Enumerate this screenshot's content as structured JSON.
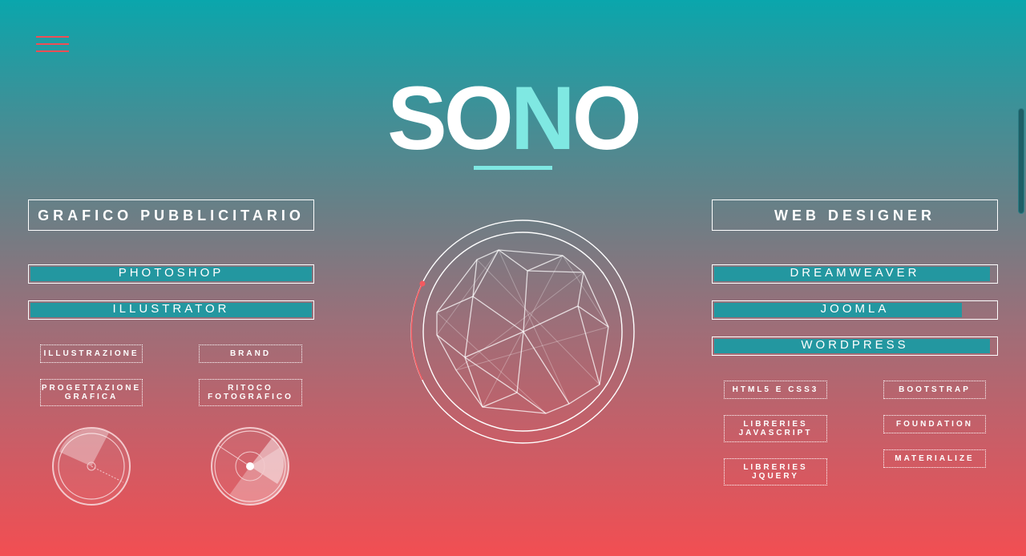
{
  "title": {
    "prefix": "SO",
    "highlight": "N",
    "suffix": "O"
  },
  "left": {
    "role": "GRAFICO PUBBLICITARIO",
    "skills": [
      {
        "label": "PHOTOSHOP",
        "level": 1.0
      },
      {
        "label": "ILLUSTRATOR",
        "level": 1.0
      }
    ],
    "tags": [
      "ILLUSTRAZIONE",
      "BRAND",
      "PROGETTAZIONE\nGRAFICA",
      "RITOCO\nFOTOGRAFICO"
    ]
  },
  "right": {
    "role": "WEB DESIGNER",
    "skills": [
      {
        "label": "DREAMWEAVER",
        "level": 0.98
      },
      {
        "label": "JOOMLA",
        "level": 0.88
      },
      {
        "label": "WORDPRESS",
        "level": 0.98
      }
    ],
    "tags": [
      "HTML5 E CSS3",
      "BOOTSTRAP",
      "LIBRERIES\nJAVASCRIPT",
      "FOUNDATION",
      "LIBRERIES\nJQUERY",
      "MATERIALIZE"
    ]
  },
  "colors": {
    "accent": "#7fe8e2",
    "bar_fill": "#2397a0",
    "menu": "#f04e55"
  },
  "icons": [
    "hamburger-menu-icon",
    "polyhedron-graphic",
    "radar-gauge-icon"
  ]
}
